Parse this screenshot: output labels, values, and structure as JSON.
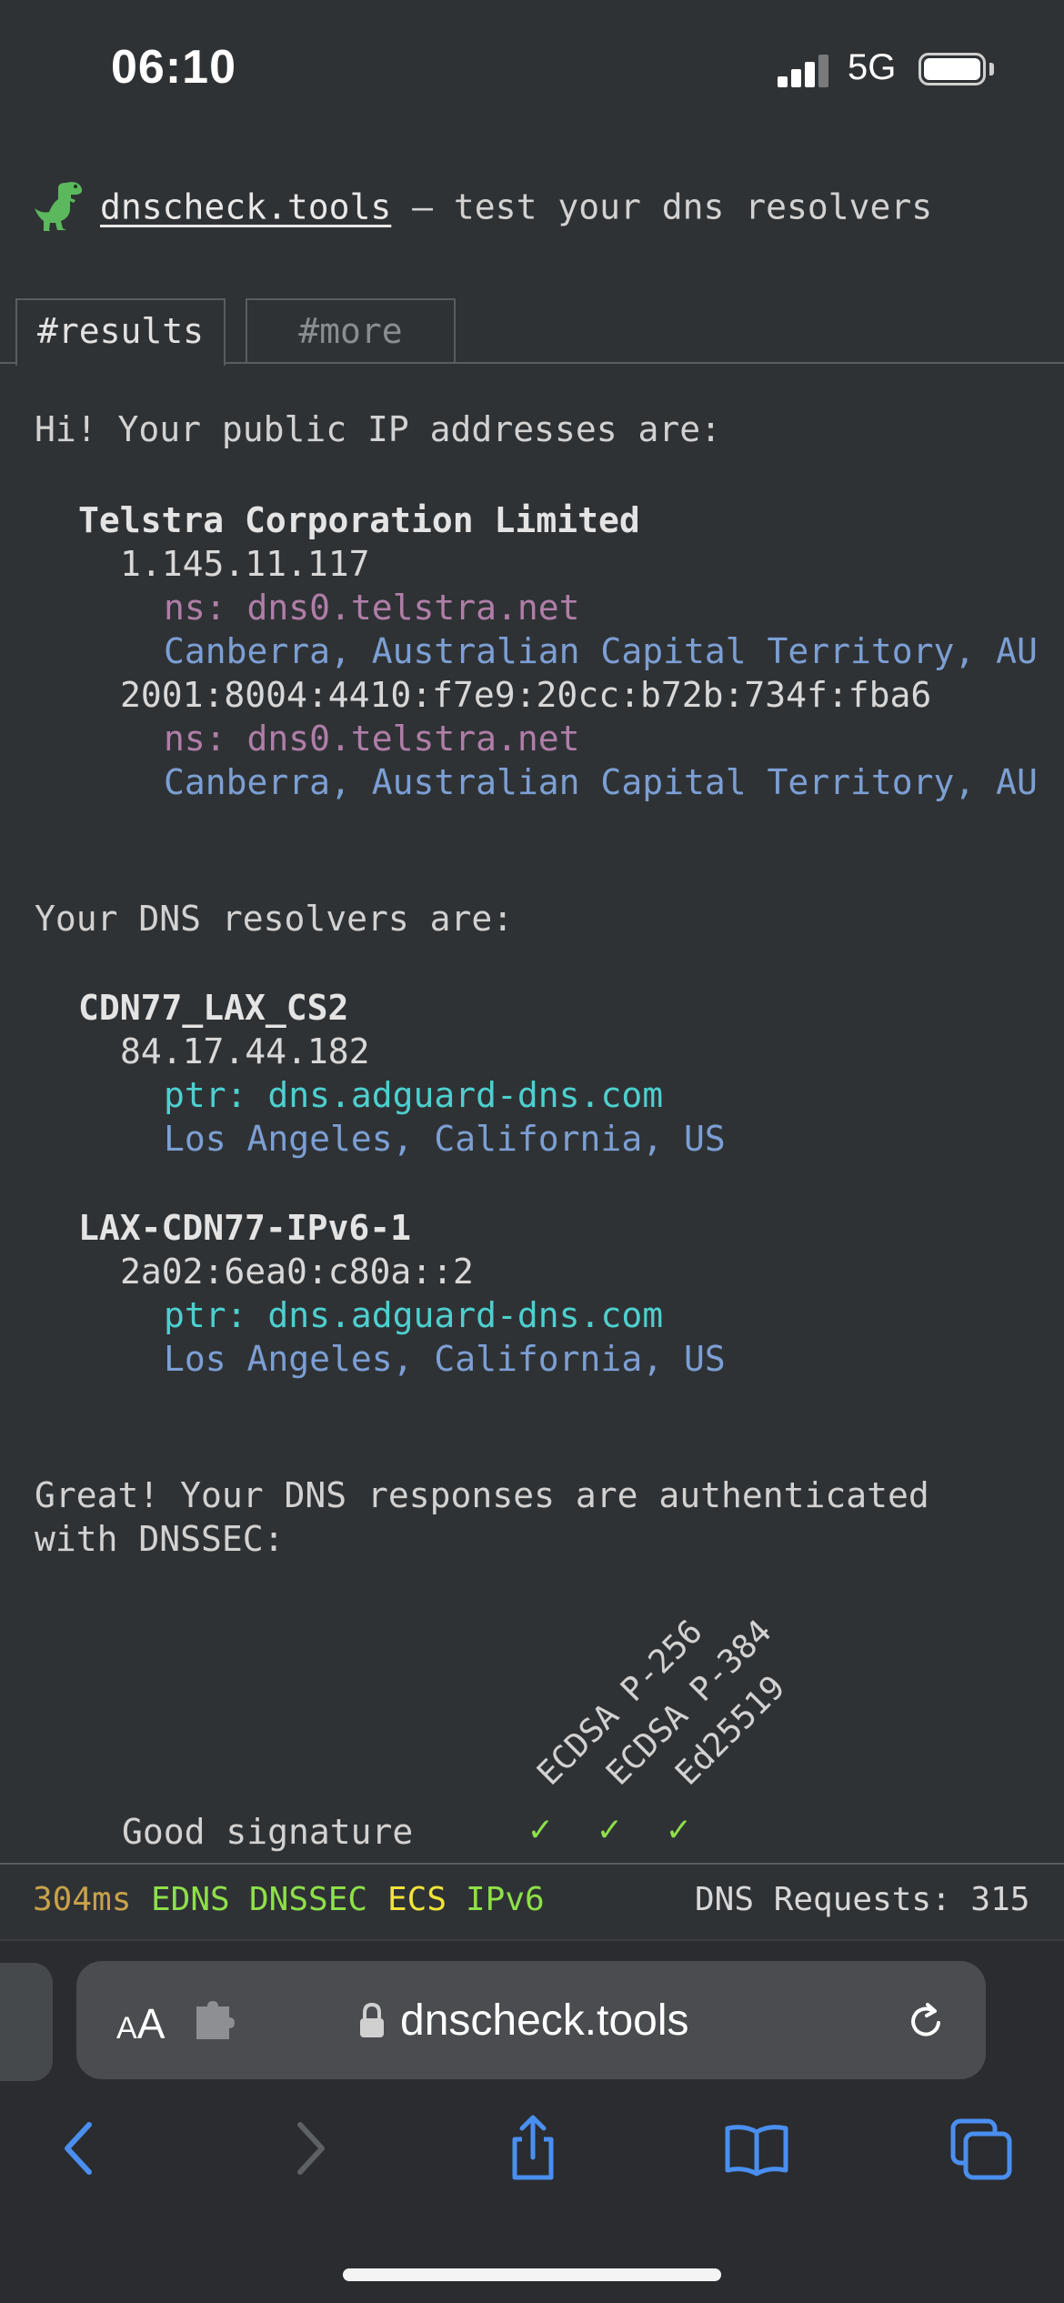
{
  "status_bar": {
    "time": "06:10",
    "network": "5G"
  },
  "header": {
    "site": "dnscheck.tools",
    "tagline": " – test your dns resolvers"
  },
  "tabs": [
    {
      "label": "#results"
    },
    {
      "label": "#more"
    }
  ],
  "public_ip": {
    "intro": "Hi! Your public IP addresses are:",
    "org": "Telstra Corporation Limited",
    "addresses": [
      {
        "ip": "1.145.11.117",
        "ns": "ns: dns0.telstra.net",
        "location": "Canberra, Australian Capital Territory, AU"
      },
      {
        "ip": "2001:8004:4410:f7e9:20cc:b72b:734f:fba6",
        "ns": "ns: dns0.telstra.net",
        "location": "Canberra, Australian Capital Territory, AU"
      }
    ]
  },
  "resolvers": {
    "intro": "Your DNS resolvers are:",
    "items": [
      {
        "name": "CDN77_LAX_CS2",
        "ip": "84.17.44.182",
        "ptr_label": "ptr: ",
        "ptr": "dns.adguard-dns.com",
        "location": "Los Angeles, California, US"
      },
      {
        "name": "LAX-CDN77-IPv6-1",
        "ip": "2a02:6ea0:c80a::2",
        "ptr_label": "ptr: ",
        "ptr": "dns.adguard-dns.com",
        "location": "Los Angeles, California, US"
      }
    ]
  },
  "dnssec": {
    "line1": "Great! Your DNS responses are authenticated",
    "line2": "with DNSSEC:",
    "algorithms": [
      "ECDSA P-256",
      "ECDSA P-384",
      "Ed25519"
    ],
    "row_label": "Good signature",
    "checks": [
      "✓",
      "✓",
      "✓"
    ]
  },
  "footer": {
    "latency": "304ms",
    "flags": [
      {
        "label": "EDNS",
        "color": "#8ee04a"
      },
      {
        "label": "DNSSEC",
        "color": "#8ee04a"
      },
      {
        "label": "ECS",
        "color": "#f2e33a"
      },
      {
        "label": "IPv6",
        "color": "#8ee04a"
      }
    ],
    "requests": "DNS Requests: 315"
  },
  "browser": {
    "text_size": "AA",
    "url": "dnscheck.tools"
  },
  "colors": {
    "background": "#2f3235",
    "ns": "#b07ea8",
    "location": "#7c9fd4",
    "ptr": "#4dd0cf",
    "ok": "#8ee04a",
    "warn": "#f2e33a",
    "ios_blue": "#4a8ff0"
  }
}
